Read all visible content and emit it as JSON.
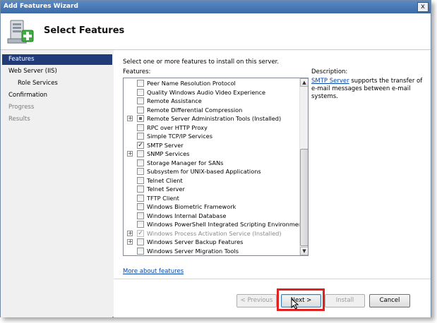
{
  "window": {
    "title": "Add Features Wizard",
    "close_glyph": "x"
  },
  "header": {
    "title": "Select Features",
    "icon": "server-features-icon"
  },
  "sidebar": {
    "items": [
      {
        "label": "Features",
        "state": "active"
      },
      {
        "label": "Web Server (IIS)",
        "state": "normal"
      },
      {
        "label": "Role Services",
        "state": "sub"
      },
      {
        "label": "Confirmation",
        "state": "normal"
      },
      {
        "label": "Progress",
        "state": "disabled"
      },
      {
        "label": "Results",
        "state": "disabled"
      }
    ]
  },
  "main": {
    "instruction": "Select one or more features to install on this server.",
    "features_label": "Features:",
    "features": [
      {
        "label": "Peer Name Resolution Protocol",
        "checked": false,
        "expander": false,
        "disabled": false
      },
      {
        "label": "Quality Windows Audio Video Experience",
        "checked": false,
        "expander": false,
        "disabled": false
      },
      {
        "label": "Remote Assistance",
        "checked": false,
        "expander": false,
        "disabled": false
      },
      {
        "label": "Remote Differential Compression",
        "checked": false,
        "expander": false,
        "disabled": false
      },
      {
        "label": "Remote Server Administration Tools  (Installed)",
        "checked": "partial",
        "expander": true,
        "disabled": false
      },
      {
        "label": "RPC over HTTP Proxy",
        "checked": false,
        "expander": false,
        "disabled": false
      },
      {
        "label": "Simple TCP/IP Services",
        "checked": false,
        "expander": false,
        "disabled": false
      },
      {
        "label": "SMTP Server",
        "checked": true,
        "expander": false,
        "disabled": false
      },
      {
        "label": "SNMP Services",
        "checked": false,
        "expander": true,
        "disabled": false
      },
      {
        "label": "Storage Manager for SANs",
        "checked": false,
        "expander": false,
        "disabled": false
      },
      {
        "label": "Subsystem for UNIX-based Applications",
        "checked": false,
        "expander": false,
        "disabled": false
      },
      {
        "label": "Telnet Client",
        "checked": false,
        "expander": false,
        "disabled": false
      },
      {
        "label": "Telnet Server",
        "checked": false,
        "expander": false,
        "disabled": false
      },
      {
        "label": "TFTP Client",
        "checked": false,
        "expander": false,
        "disabled": false
      },
      {
        "label": "Windows Biometric Framework",
        "checked": false,
        "expander": false,
        "disabled": false
      },
      {
        "label": "Windows Internal Database",
        "checked": false,
        "expander": false,
        "disabled": false
      },
      {
        "label": "Windows PowerShell Integrated Scripting Environment (IS",
        "checked": false,
        "expander": false,
        "disabled": false
      },
      {
        "label": "Windows Process Activation Service  (Installed)",
        "checked": true,
        "expander": true,
        "disabled": true
      },
      {
        "label": "Windows Server Backup Features",
        "checked": false,
        "expander": true,
        "disabled": false
      },
      {
        "label": "Windows Server Migration Tools",
        "checked": false,
        "expander": false,
        "disabled": false
      }
    ],
    "more_link": "More about features",
    "description_label": "Description:",
    "description_link": "SMTP Server",
    "description_text": " supports the transfer of e-mail messages between e-mail systems."
  },
  "buttons": {
    "previous": "< Previous",
    "next": "Next >",
    "install": "Install",
    "cancel": "Cancel"
  },
  "colors": {
    "active_nav": "#203b78",
    "highlight": "#e0211f",
    "link": "#0645ad"
  }
}
